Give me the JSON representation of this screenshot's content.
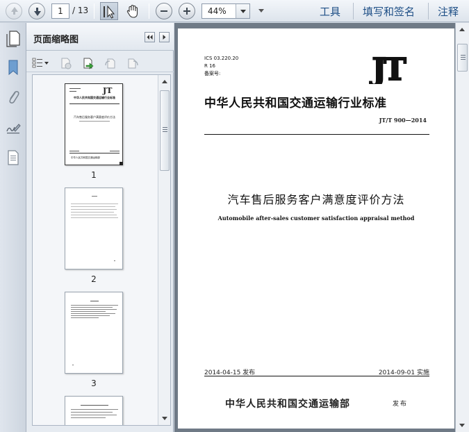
{
  "toolbar": {
    "page_current": "1",
    "page_total": "/ 13",
    "zoom": "44%",
    "tools_label": "工具",
    "sign_label": "填写和签名",
    "comment_label": "注释"
  },
  "panel": {
    "title": "页面缩略图",
    "thumbnails": [
      {
        "label": "1"
      },
      {
        "label": "2"
      },
      {
        "label": "3"
      }
    ]
  },
  "document": {
    "ics": "ICS 03.220.20",
    "class_code": "R 16",
    "record_no": "备案号:",
    "logo_text": "JT",
    "standard_title": "中华人民共和国交通运输行业标准",
    "standard_no": "JT/T 900—2014",
    "title_cn": "汽车售后服务客户满意度评价方法",
    "title_en": "Automobile after-sales customer satisfaction appraisal method",
    "release_date": "2014-04-15 发布",
    "implement_date": "2014-09-01 实施",
    "issuer": "中华人民共和国交通运输部",
    "issue_word": "发布"
  },
  "thumb1": {
    "logo_text": "JT",
    "standard_title": "中华人民共和国交通运输行业标准",
    "title_cn": "汽车售后服务客户满意度评价方法",
    "issuer": "中华人民共和国交通运输部"
  },
  "colors": {
    "link": "#1e4f86",
    "doc_bg": "#6f7a86",
    "panel_bg": "#e6ebf1"
  }
}
